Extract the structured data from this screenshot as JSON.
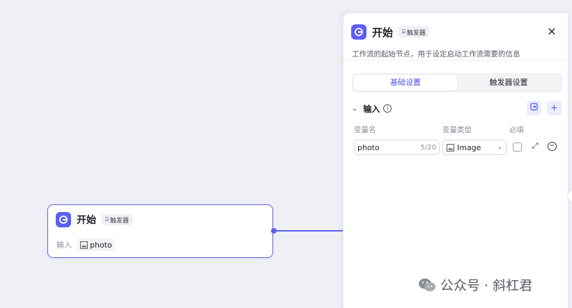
{
  "node": {
    "title": "开始",
    "badge": "触发器",
    "input_label": "输入",
    "input_var": "photo"
  },
  "panel": {
    "title": "开始",
    "badge": "触发器",
    "description": "工作流的起始节点，用于设定启动工作流需要的信息",
    "close_icon": "close-icon",
    "tabs": [
      {
        "label": "基础设置",
        "active": true
      },
      {
        "label": "触发器设置",
        "active": false
      }
    ],
    "section": {
      "title": "输入",
      "columns": [
        "变量名",
        "变量类型",
        "必填"
      ],
      "rows": [
        {
          "name": "photo",
          "counter": "5/20",
          "type": "Image",
          "required": false
        }
      ]
    }
  },
  "watermark": {
    "text": "公众号 · 斜杠君"
  },
  "colors": {
    "accent": "#5b5ff2",
    "canvas_bg": "#eef0f5",
    "panel_bg": "#ffffff"
  }
}
